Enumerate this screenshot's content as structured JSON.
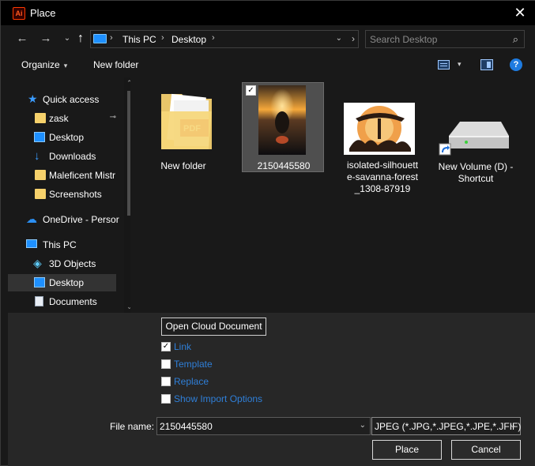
{
  "window": {
    "title": "Place",
    "app_icon_text": "Ai",
    "close_glyph": "✕"
  },
  "nav": {
    "back": "←",
    "forward": "→",
    "recent": "⌄",
    "up": "↑",
    "address": [
      "This PC",
      "Desktop"
    ],
    "separator": "›",
    "search_placeholder": "Search Desktop",
    "search_icon": "⌕",
    "dropdown_glyph": "⌄",
    "refresh_glyph": "›"
  },
  "toolbar": {
    "organize": "Organize",
    "caret": "▾",
    "new_folder": "New folder",
    "help": "?"
  },
  "sidebar": {
    "items": [
      {
        "label": "Quick access",
        "icon": "star-icon"
      },
      {
        "label": "zask",
        "icon": "folder-icon",
        "pinned": true
      },
      {
        "label": "Desktop",
        "icon": "desktop-icon"
      },
      {
        "label": "Downloads",
        "icon": "download-icon"
      },
      {
        "label": "Maleficent Mistr",
        "icon": "folder-icon"
      },
      {
        "label": "Screenshots",
        "icon": "folder-icon"
      },
      {
        "label": "OneDrive - Persor",
        "icon": "cloud-icon"
      },
      {
        "label": "This PC",
        "icon": "computer-icon"
      },
      {
        "label": "3D Objects",
        "icon": "cube-icon"
      },
      {
        "label": "Desktop",
        "icon": "desktop-icon",
        "selected": true
      },
      {
        "label": "Documents",
        "icon": "document-icon"
      }
    ],
    "pin_glyph": "⊸",
    "scroll_up": "⌃",
    "scroll_down": "⌄"
  },
  "files": [
    {
      "name": "New folder",
      "type": "folder"
    },
    {
      "name": "2150445580",
      "type": "image",
      "selected": true,
      "checked": "✓"
    },
    {
      "name": "isolated-silhouett e-savanna-forest _1308-87919",
      "type": "image"
    },
    {
      "name": "New Volume (D) - Shortcut",
      "type": "drive-shortcut"
    }
  ],
  "options": {
    "open_cloud": "Open Cloud Document",
    "check_glyph": "✓",
    "checkboxes": [
      {
        "label": "Link",
        "checked": true
      },
      {
        "label": "Template",
        "checked": false
      },
      {
        "label": "Replace",
        "checked": false
      },
      {
        "label": "Show Import Options",
        "checked": false
      }
    ]
  },
  "footer": {
    "file_name_label": "File name:",
    "file_name_value": "2150445580",
    "file_type": "JPEG (*.JPG,*.JPEG,*.JPE,*.JFIF)",
    "dropdown_glyph": "⌄",
    "place": "Place",
    "cancel": "Cancel"
  },
  "colors": {
    "link_blue": "#2f7fd8",
    "accent_blue": "#1e90ff",
    "title_bg": "#000000",
    "panel_bg": "#272727"
  }
}
